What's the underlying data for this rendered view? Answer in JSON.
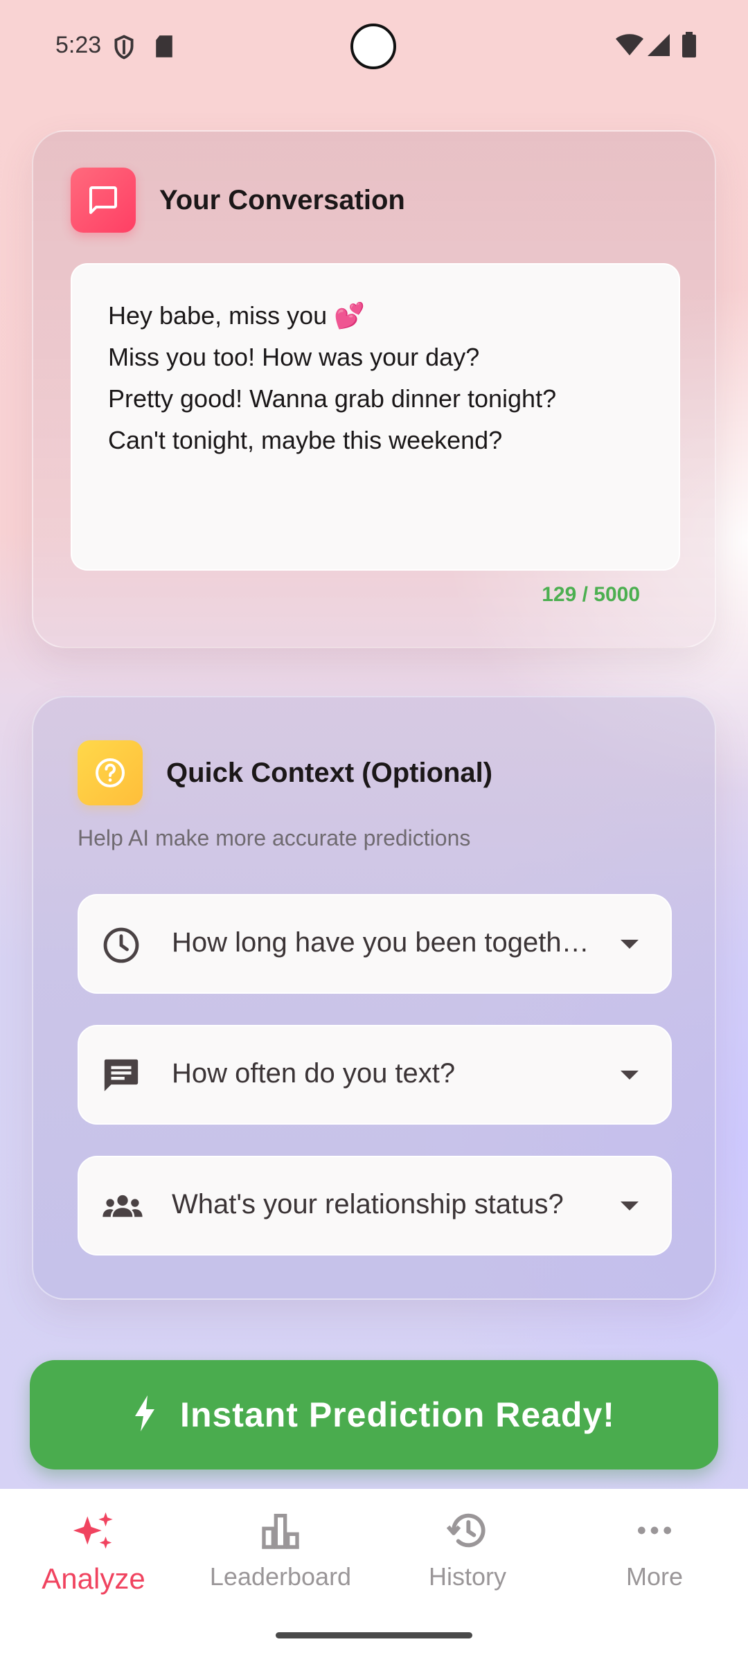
{
  "status_bar": {
    "time": "5:23"
  },
  "conversation_card": {
    "title": "Your Conversation",
    "icon": "chat-bubble-icon",
    "messages": [
      "Hey babe, miss you 💕",
      "Miss you too! How was your day?",
      "Pretty good! Wanna grab dinner tonight?",
      "Can't tonight, maybe this weekend?"
    ],
    "char_count": "129 / 5000"
  },
  "context_card": {
    "title": "Quick Context (Optional)",
    "icon": "question-circle-icon",
    "hint": "Help AI make more accurate predictions",
    "dropdowns": [
      {
        "label": "How long have you been together?",
        "icon": "clock-icon"
      },
      {
        "label": "How often do you text?",
        "icon": "message-icon"
      },
      {
        "label": "What's your relationship status?",
        "icon": "people-icon"
      }
    ]
  },
  "cta": {
    "label": "Instant Prediction Ready!",
    "icon": "bolt-icon"
  },
  "nav": {
    "items": [
      {
        "label": "Analyze",
        "icon": "sparkles-icon",
        "active": true
      },
      {
        "label": "Leaderboard",
        "icon": "bar-chart-icon",
        "active": false
      },
      {
        "label": "History",
        "icon": "history-icon",
        "active": false
      },
      {
        "label": "More",
        "icon": "more-horizontal-icon",
        "active": false
      }
    ]
  },
  "colors": {
    "accent_pink": "#f0435f",
    "success_green": "#4aac4e",
    "count_green": "#4caf50",
    "icon_yellow": "#ffc93f"
  }
}
